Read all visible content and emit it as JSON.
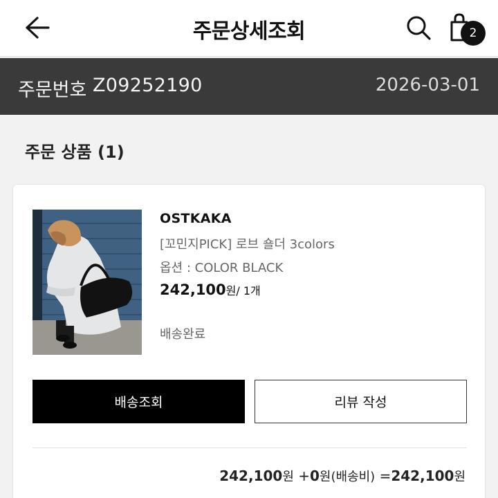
{
  "header": {
    "title": "주문상세조회",
    "cart_count": "2"
  },
  "order": {
    "label": "주문번호",
    "number": "Z09252190",
    "date": "2026-03-01"
  },
  "section": {
    "title": "주문 상품",
    "count": "(1)"
  },
  "product": {
    "brand": "OSTKAKA",
    "name": "[꼬민지PICK] 로브 숄더 3colors",
    "option": "옵션 : COLOR BLACK",
    "price": "242,100",
    "price_unit": "원",
    "quantity": "/ 1개",
    "status": "배송완료"
  },
  "buttons": {
    "track": "배송조회",
    "review": "리뷰 작성"
  },
  "summary": {
    "item_amount": "242,100",
    "item_unit": "원",
    "shipping_prefix": " +",
    "shipping_amount": "0",
    "shipping_unit": "원(배송비)",
    "equals": " =",
    "total_amount": "242,100",
    "total_unit": "원"
  },
  "colors": {
    "order_bar": "#3a3a3a",
    "primary_button": "#000000",
    "page_background": "#f2f2f2"
  }
}
